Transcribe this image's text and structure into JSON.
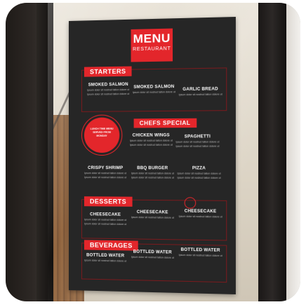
{
  "menu": {
    "title": "MENU",
    "subtitle": "RESTAURANT"
  },
  "sections": {
    "starters": "STARTERS",
    "desserts": "DESSERTS",
    "beverages": "BEVERAGES",
    "special": "CHEFS SPECIAL"
  },
  "items": {
    "smoked_salmon_1": "SMOKED SALMON",
    "smoked_salmon_2": "SMOKED SALMON",
    "garlic_bread": "GARLIC BREAD",
    "chicken_wings": "CHICKEN WINGS",
    "spaghetti": "SPAGHETTI",
    "crispy_shrimp": "CRISPY SHRIMP",
    "bbq_burger": "BBQ BURGER",
    "pizza": "PIZZA",
    "cheesecake_1": "CHEESECAKE",
    "cheesecake_2": "CHEESECAKE",
    "cheesecake_3": "CHEESECAKE",
    "bottled_water_1": "BOTTLED WATER",
    "bottled_water_2": "BOTTLED WATER",
    "bottled_water_3": "BOTTLED WATER"
  },
  "promo": {
    "text": "LUNCH TIME MENU SERVED FROM MONDAY"
  },
  "desc_placeholder": "Ipsum dolor sit nostrud tation dolore ut",
  "colors": {
    "accent": "#e3262b",
    "poster": "#262626"
  }
}
